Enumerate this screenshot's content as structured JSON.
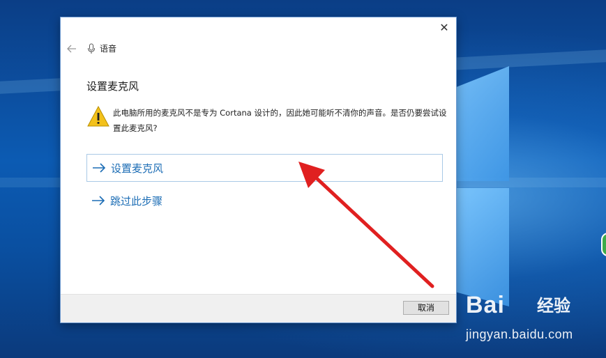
{
  "dialog": {
    "title": "语音",
    "close_glyph": "✕",
    "heading": "设置麦克风",
    "warning_text": "此电脑所用的麦克风不是专为 Cortana 设计的，因此她可能听不清你的声音。是否仍要尝试设置此麦克风?",
    "options": [
      {
        "label": "设置麦克风",
        "icon": "arrow-right-icon",
        "selected": true
      },
      {
        "label": "跳过此步骤",
        "icon": "arrow-right-icon",
        "selected": false
      }
    ],
    "cancel_label": "取消"
  },
  "watermark": {
    "brand": "Bai",
    "brand_suffix": "经验",
    "url": "jingyan.baidu.com"
  },
  "colors": {
    "link": "#1c6db5",
    "annotation_arrow": "#e02020",
    "warning": "#f3c11b"
  }
}
